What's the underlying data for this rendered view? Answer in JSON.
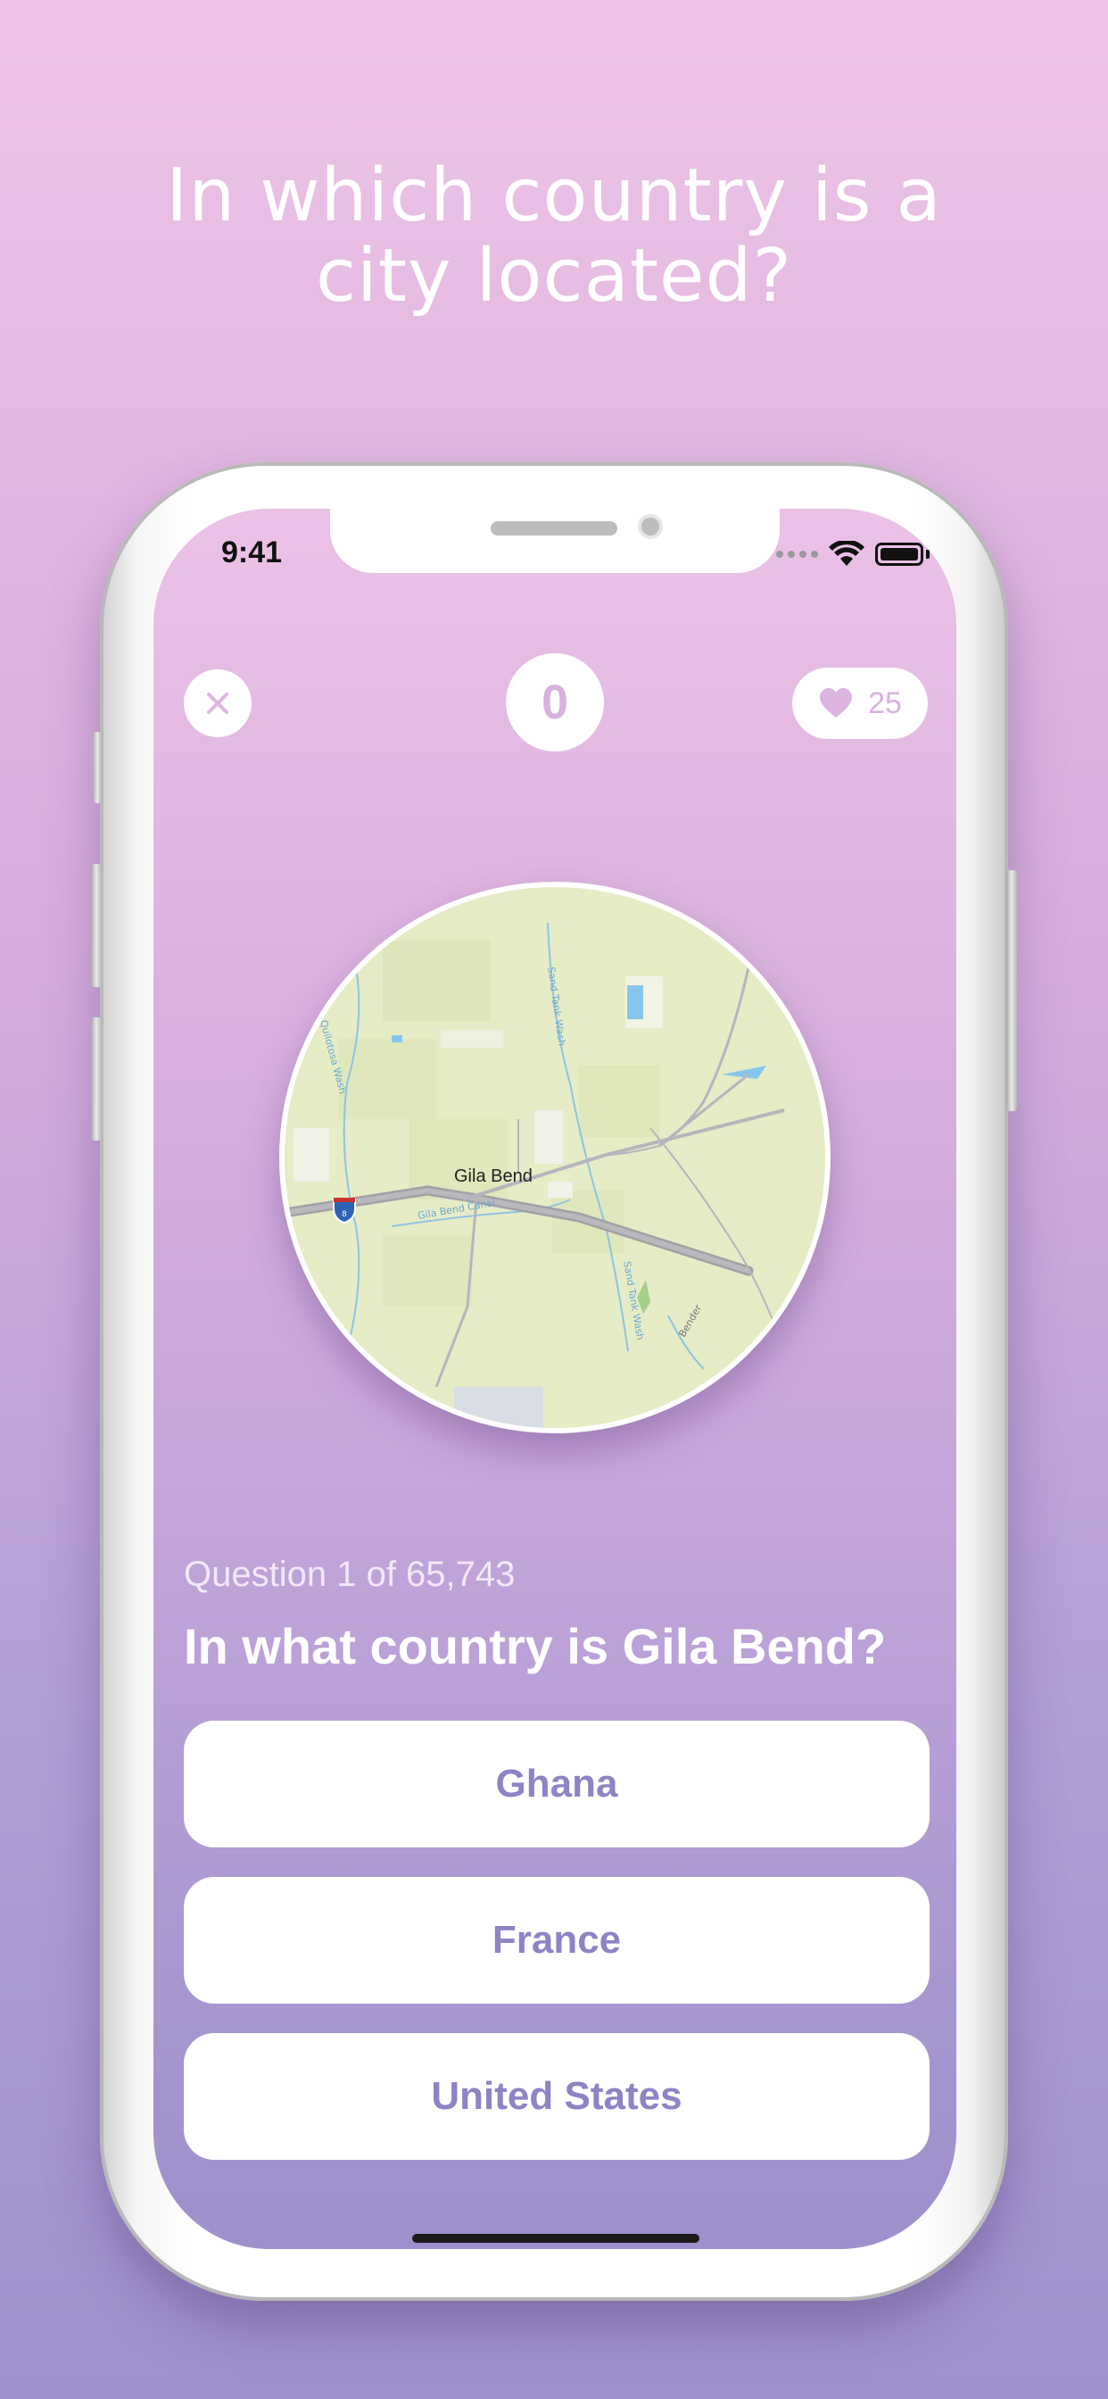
{
  "promo": {
    "headline_line1": "In which country is a",
    "headline_line2": "city located?"
  },
  "status_bar": {
    "time": "9:41"
  },
  "top_bar": {
    "close_icon": "close-icon",
    "score": "0",
    "lives_icon": "heart-icon",
    "lives": "25"
  },
  "map": {
    "city_label": "Gila Bend",
    "highway_shield": "8",
    "labels": {
      "wash1": "Quilotosa Wash",
      "wash2": "Sand Tank Wash",
      "wash3": "Sand Tank Wash",
      "canal": "Gila Bend Canal",
      "road": "Bender"
    }
  },
  "question": {
    "counter": "Question 1 of 65,743",
    "text": "In what country is Gila Bend?"
  },
  "answers": [
    "Ghana",
    "France",
    "United States"
  ],
  "colors": {
    "accent": "#8e83c4",
    "score_text": "#d8b2de",
    "map_land": "#e6ecc6"
  }
}
